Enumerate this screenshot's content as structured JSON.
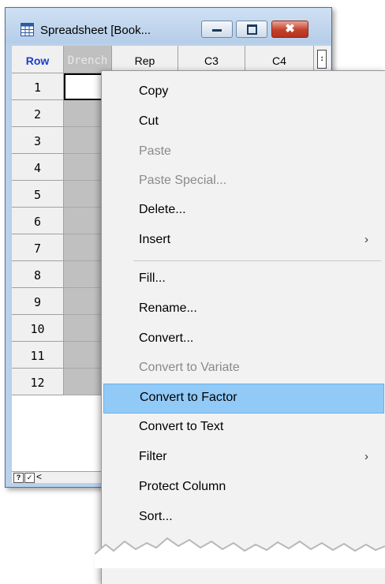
{
  "window": {
    "title": "Spreadsheet [Book...",
    "minimize_glyph": "▭",
    "maximize_glyph": "▢",
    "close_glyph": "✖"
  },
  "grid": {
    "corner_label": "Row",
    "columns": [
      "Drench",
      "Rep",
      "C3",
      "C4"
    ],
    "rows": [
      "1",
      "2",
      "3",
      "4",
      "5",
      "6",
      "7",
      "8",
      "9",
      "10",
      "11",
      "12"
    ],
    "scroll_glyph": "↕"
  },
  "statusbar": {
    "help": "?",
    "check": "✓",
    "scroll_left": "<"
  },
  "menu": {
    "items": [
      {
        "label": "Copy",
        "enabled": true
      },
      {
        "label": "Cut",
        "enabled": true
      },
      {
        "label": "Paste",
        "enabled": false
      },
      {
        "label": "Paste Special...",
        "enabled": false
      },
      {
        "label": "Delete...",
        "enabled": true
      },
      {
        "label": "Insert",
        "enabled": true,
        "submenu": true
      },
      {
        "label": "Fill...",
        "enabled": true
      },
      {
        "label": "Rename...",
        "enabled": true
      },
      {
        "label": "Convert...",
        "enabled": true
      },
      {
        "label": "Convert to Variate",
        "enabled": false
      },
      {
        "label": "Convert to Factor",
        "enabled": true,
        "highlighted": true
      },
      {
        "label": "Convert to Text",
        "enabled": true
      },
      {
        "label": "Filter",
        "enabled": true,
        "submenu": true
      },
      {
        "label": "Protect Column",
        "enabled": true
      },
      {
        "label": "Sort...",
        "enabled": true
      }
    ],
    "submenu_arrow": "›"
  },
  "colors": {
    "highlight": "#91c9f7",
    "accent_header": "#1a3ec9",
    "close_button": "#c4402b"
  }
}
